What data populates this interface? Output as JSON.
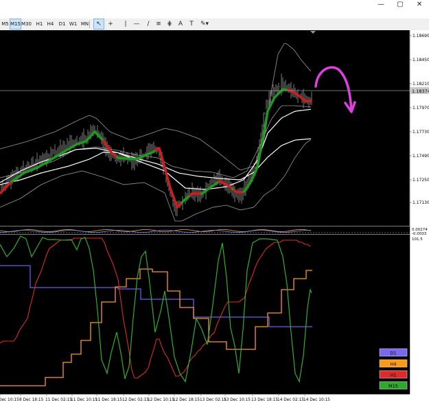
{
  "window_controls": {
    "minimize": "—",
    "maximize": "▢",
    "close": "✕"
  },
  "toolbar": {
    "timeframes": [
      "M5",
      "M15",
      "M30",
      "H1",
      "H4",
      "D1",
      "W1",
      "MN"
    ],
    "active_timeframe": "M15",
    "tools": [
      {
        "name": "cursor-tool",
        "glyph": "↖"
      },
      {
        "name": "crosshair-tool",
        "glyph": "+"
      },
      {
        "name": "vertical-line-tool",
        "glyph": "|"
      },
      {
        "name": "horizontal-line-tool",
        "glyph": "—"
      },
      {
        "name": "trendline-tool",
        "glyph": "/"
      },
      {
        "name": "channel-tool",
        "glyph": "≡"
      },
      {
        "name": "fibonacci-tool",
        "glyph": "⋕"
      },
      {
        "name": "text-tool",
        "glyph": "A"
      },
      {
        "name": "label-tool",
        "glyph": "T"
      },
      {
        "name": "shapes-tool",
        "glyph": "✎▾"
      }
    ]
  },
  "price_axis": {
    "labels": [
      "1.18690",
      "1.18450",
      "1.18210",
      "1.17970",
      "1.17730",
      "1.17490",
      "1.17250",
      "1.17130"
    ],
    "current_price": "1.18374"
  },
  "volume_panel": {
    "labels": [
      "0.00274",
      "-0.0033"
    ]
  },
  "oscillator_panel": {
    "top_label": "101.5"
  },
  "time_axis": {
    "labels": [
      "Dec 10:15",
      "8 Dec 18:15",
      "11 Dec 02:15",
      "11 Dec 10:15",
      "11 Dec 18:15",
      "12 Dec 02:15",
      "12 Dec 10:15",
      "12 Dec 18:15",
      "13 Dec 02:15",
      "13 Dec 10:15",
      "13 Dec 18:15",
      "14 Dec 02:15",
      "14 Dec 10:15"
    ]
  },
  "legend": [
    {
      "label": "D1",
      "color": "#7b68ee"
    },
    {
      "label": "H4",
      "color": "#ff9a1a"
    },
    {
      "label": "H1",
      "color": "#dd2a2a"
    },
    {
      "label": "M15",
      "color": "#2fa82f"
    }
  ],
  "colors": {
    "background": "#000000",
    "fast_ma_up": "#1f9a1f",
    "fast_ma_down": "#cc1e1e",
    "slow_ma": "#ffffff",
    "bands": "#9a9a9a",
    "annotation": "#e040e0",
    "d1_line": "#6a5cf0",
    "h4_line": "#ff9a1a",
    "h1_line": "#dd2a2a",
    "m15_line": "#2fb02f"
  }
}
